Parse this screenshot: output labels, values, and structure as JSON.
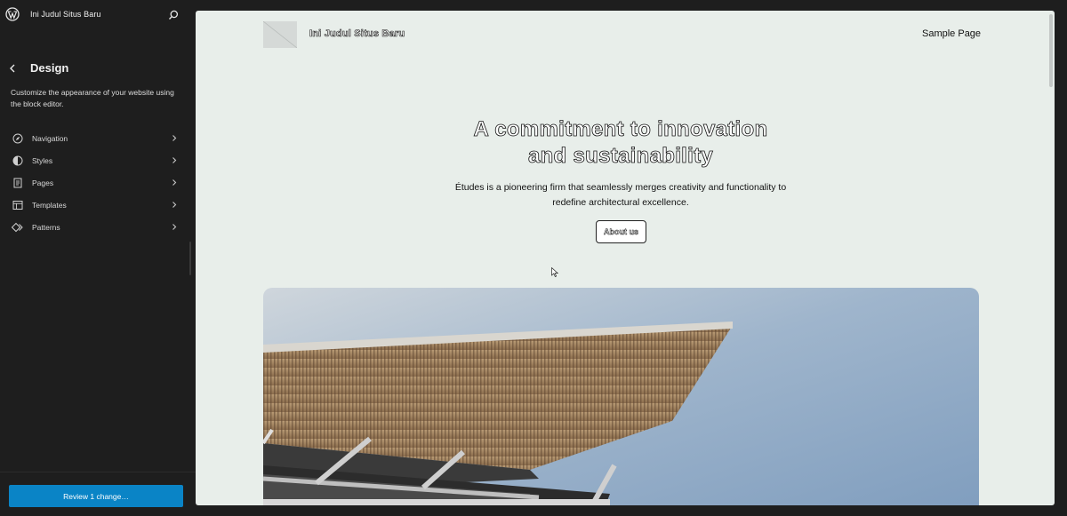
{
  "sidebar": {
    "site_name": "Ini Judul Situs Baru",
    "title": "Design",
    "description": "Customize the appearance of your website using the block editor.",
    "items": [
      {
        "label": "Navigation",
        "icon": "navigation-icon"
      },
      {
        "label": "Styles",
        "icon": "styles-icon"
      },
      {
        "label": "Pages",
        "icon": "pages-icon"
      },
      {
        "label": "Templates",
        "icon": "templates-icon"
      },
      {
        "label": "Patterns",
        "icon": "patterns-icon"
      }
    ],
    "review_button": "Review 1 change…"
  },
  "preview": {
    "site_title": "Ini Judul Situs Baru",
    "nav_link": "Sample Page",
    "headline_line1": "A commitment to innovation",
    "headline_line2": "and sustainability",
    "subtext": "Études is a pioneering firm that seamlessly merges creativity and functionality to redefine architectural excellence.",
    "about_button": "About us"
  },
  "colors": {
    "sidebar_bg": "#1e1e1e",
    "accent": "#0a84c6",
    "preview_bg": "#e8eeea"
  }
}
